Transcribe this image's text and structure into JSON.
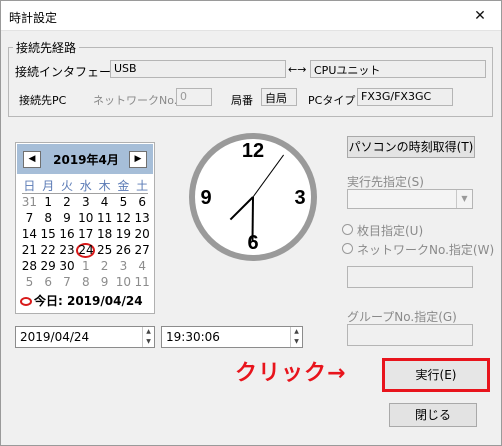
{
  "window": {
    "title": "時計設定",
    "close_glyph": "✕"
  },
  "connection": {
    "legend": "接続先経路",
    "interface_label": "接続インタフェース",
    "interface_value": "USB",
    "arrow": "←→",
    "target_value": "CPUユニット",
    "target_label": "接続先PC",
    "network_label": "ネットワークNo.",
    "network_value": "0",
    "station_label": "局番",
    "station_value": "自局",
    "pc_type_label": "PCタイプ",
    "pc_type_value": "FX3G/FX3GC"
  },
  "calendar": {
    "prev_glyph": "◀",
    "next_glyph": "▶",
    "month_title": "2019年4月",
    "weekdays": [
      "日",
      "月",
      "火",
      "水",
      "木",
      "金",
      "土"
    ],
    "days": [
      {
        "d": "31",
        "other": true
      },
      {
        "d": "1"
      },
      {
        "d": "2"
      },
      {
        "d": "3"
      },
      {
        "d": "4"
      },
      {
        "d": "5"
      },
      {
        "d": "6"
      },
      {
        "d": "7"
      },
      {
        "d": "8"
      },
      {
        "d": "9"
      },
      {
        "d": "10"
      },
      {
        "d": "11"
      },
      {
        "d": "12"
      },
      {
        "d": "13"
      },
      {
        "d": "14"
      },
      {
        "d": "15"
      },
      {
        "d": "16"
      },
      {
        "d": "17"
      },
      {
        "d": "18"
      },
      {
        "d": "19"
      },
      {
        "d": "20"
      },
      {
        "d": "21"
      },
      {
        "d": "22"
      },
      {
        "d": "23"
      },
      {
        "d": "24",
        "today": true
      },
      {
        "d": "25"
      },
      {
        "d": "26"
      },
      {
        "d": "27"
      },
      {
        "d": "28"
      },
      {
        "d": "29"
      },
      {
        "d": "30"
      },
      {
        "d": "1",
        "other": true
      },
      {
        "d": "2",
        "other": true
      },
      {
        "d": "3",
        "other": true
      },
      {
        "d": "4",
        "other": true
      },
      {
        "d": "5",
        "other": true
      },
      {
        "d": "6",
        "other": true
      },
      {
        "d": "7",
        "other": true
      },
      {
        "d": "8",
        "other": true
      },
      {
        "d": "9",
        "other": true
      },
      {
        "d": "10",
        "other": true
      },
      {
        "d": "11",
        "other": true
      }
    ],
    "today_text": "今日: 2019/04/24"
  },
  "date_input": {
    "value": "2019/04/24"
  },
  "time_input": {
    "value": "19:30:06"
  },
  "clock": {
    "numerals": [
      "12",
      "3",
      "6",
      "9"
    ],
    "hour": 19,
    "minute": 30,
    "second": 6
  },
  "right_panel": {
    "get_pc_time_label": "パソコンの時刻取得(T)",
    "exec_target_label": "実行先指定(S)",
    "radio_batch_label": "枚目指定(U)",
    "radio_network_label": "ネットワークNo.指定(W)",
    "group_label": "グループNo.指定(G)",
    "execute_label": "実行(E)",
    "close_label": "閉じる"
  },
  "annotation": {
    "click_text": "クリック→"
  },
  "colors": {
    "highlight": "#e8141c",
    "calendar_header": "#a6bed8"
  }
}
